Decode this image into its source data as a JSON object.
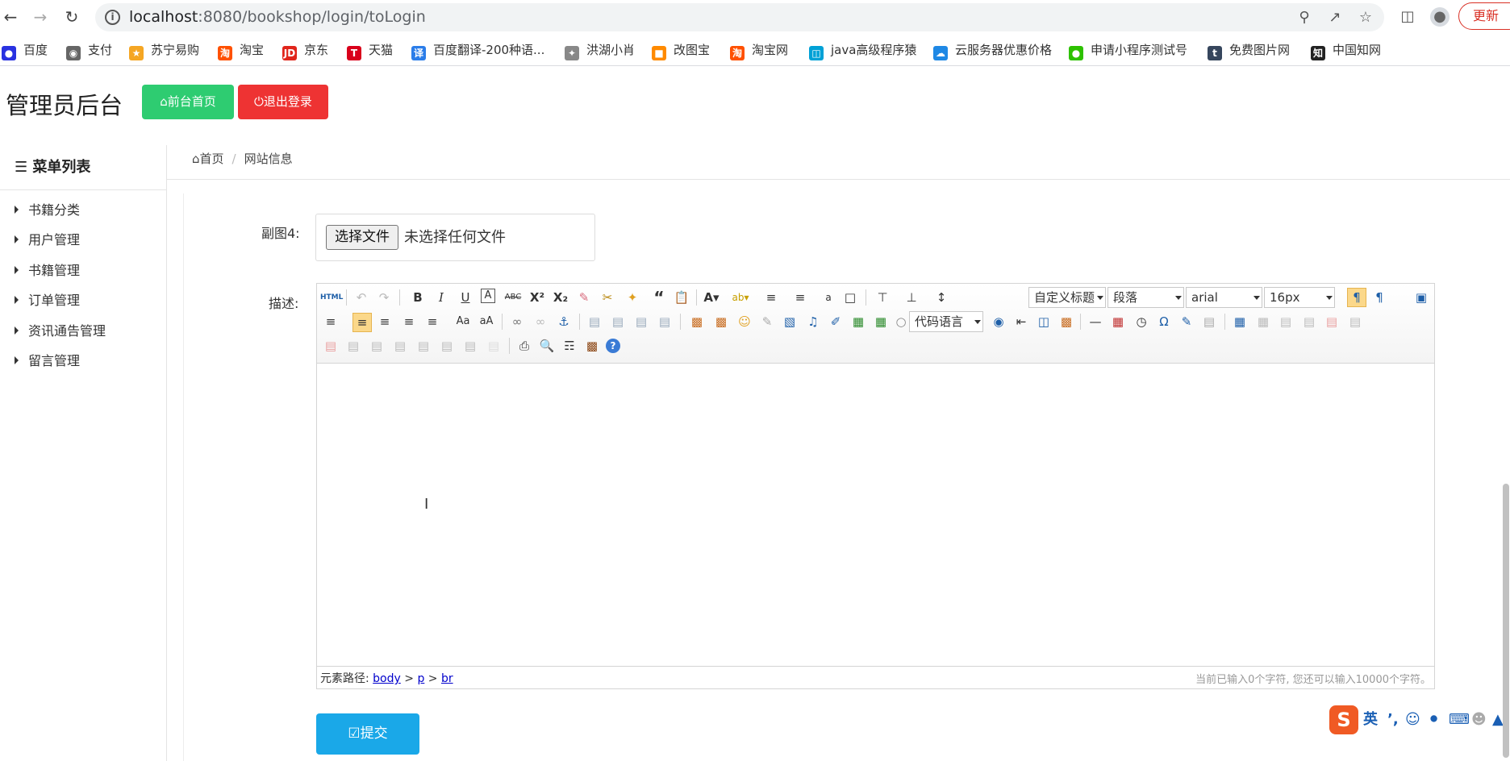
{
  "browser": {
    "url_host": "localhost",
    "url_rest": ":8080/bookshop/login/toLogin",
    "update_label": "更新"
  },
  "bookmarks": [
    {
      "label": "百度",
      "icon": "baidu-icon",
      "color": "#2932e1"
    },
    {
      "label": "支付",
      "icon": "globe-icon",
      "color": "#666666"
    },
    {
      "label": "苏宁易购",
      "icon": "suning-icon",
      "color": "#f5a623"
    },
    {
      "label": "淘宝",
      "icon": "taobao-icon",
      "color": "#ff5000"
    },
    {
      "label": "京东",
      "icon": "jd-icon",
      "color": "#e1251b"
    },
    {
      "label": "天猫",
      "icon": "tmall-icon",
      "color": "#d9001b"
    },
    {
      "label": "百度翻译-200种语...",
      "icon": "translate-icon",
      "color": "#2b7de9"
    },
    {
      "label": "洪湖小肖",
      "icon": "bird-icon",
      "color": "#888888"
    },
    {
      "label": "改图宝",
      "icon": "gaitubao-icon",
      "color": "#ff8a00"
    },
    {
      "label": "淘宝网",
      "icon": "taobao-icon",
      "color": "#ff5000"
    },
    {
      "label": "java高级程序猿",
      "icon": "bilibili-icon",
      "color": "#00a1d6"
    },
    {
      "label": "云服务器优惠价格",
      "icon": "cloud-icon",
      "color": "#1e88e5"
    },
    {
      "label": "申请小程序测试号",
      "icon": "wechat-icon",
      "color": "#2dc100"
    },
    {
      "label": "免费图片网",
      "icon": "tumblr-icon",
      "color": "#36465d"
    },
    {
      "label": "中国知网",
      "icon": "cnki-icon",
      "color": "#222222"
    }
  ],
  "header": {
    "title": "管理员后台",
    "home_button": "前台首页",
    "logout_button": "退出登录"
  },
  "sidebar": {
    "title": "菜单列表",
    "items": [
      "书籍分类",
      "用户管理",
      "书籍管理",
      "订单管理",
      "资讯通告管理",
      "留言管理"
    ]
  },
  "breadcrumb": {
    "home": "首页",
    "current": "网站信息"
  },
  "form": {
    "image4_label": "副图4:",
    "file_button": "选择文件",
    "file_status": "未选择任何文件",
    "desc_label": "描述:",
    "submit_label": "提交"
  },
  "editor": {
    "heading_select": "自定义标题",
    "paragraph_select": "段落",
    "font_select": "arial",
    "size_select": "16px",
    "code_select": "代码语言",
    "path_label": "元素路径:",
    "path_body": "body",
    "path_p": "p",
    "path_br": "br",
    "path_sep": ">",
    "char_count": "当前已输入0个字符, 您还可以输入10000个字符。"
  },
  "ime": {
    "logo": "S",
    "lang": "英"
  },
  "colors": {
    "green": "#2ecc71",
    "red": "#ee3333",
    "blue": "#1aa8e8"
  }
}
